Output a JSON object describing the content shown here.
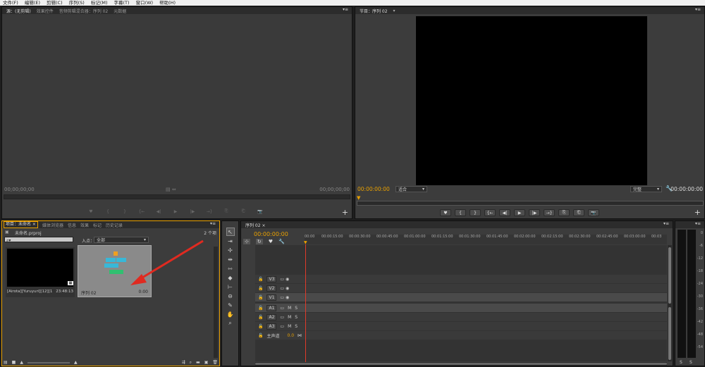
{
  "menu": [
    "文件(F)",
    "编辑(E)",
    "剪辑(C)",
    "序列(S)",
    "标记(M)",
    "字幕(T)",
    "窗口(W)",
    "帮助(H)"
  ],
  "source_panel": {
    "tabs": [
      "源：(无剪辑)",
      "效果控件",
      "音频剪辑混合器：序列 02",
      "元数据"
    ],
    "timecode_left": "00;00;00;00",
    "timecode_right": "00;00;00;00",
    "controls": [
      "♥",
      "{",
      "}",
      "{←",
      "◀|",
      "▶",
      "|▶",
      "→}",
      "⎘",
      "⎗",
      "📷"
    ]
  },
  "program_panel": {
    "tab": "节目：序列 02",
    "timecode_left": "00:00:00:00",
    "fit_select": "适合",
    "quality_select": "完整",
    "timecode_right": "00:00:00:00",
    "controls": [
      "♥",
      "{",
      "}",
      "{←",
      "◀|",
      "▶",
      "|▶",
      "→}",
      "⎘",
      "⎗",
      "📷"
    ]
  },
  "project_panel": {
    "tabs": [
      "项目：未命名",
      "媒体浏览器",
      "信息",
      "效果",
      "标记",
      "历史记录"
    ],
    "project_file": "未命名.prproj",
    "item_count": "2 个项",
    "in_label": "入点：",
    "in_select": "全部",
    "search_placeholder": "",
    "items": [
      {
        "name": "[Airota][Yuruyuri][12][1...",
        "duration": "23:48:13"
      },
      {
        "name": "序列 02",
        "duration": "0:00"
      }
    ]
  },
  "tools": [
    "selection",
    "track-select",
    "ripple",
    "rolling",
    "rate-stretch",
    "razor",
    "slip",
    "slide",
    "pen",
    "hand",
    "zoom"
  ],
  "timeline": {
    "tab": "序列 02",
    "timecode": "00:00:00:00",
    "ruler": [
      "00:00",
      "00:00:15:00",
      "00:00:30:00",
      "00:00:45:00",
      "00:01:00:00",
      "00:01:15:00",
      "00:01:30:00",
      "00:01:45:00",
      "00:02:00:00",
      "00:02:15:00",
      "00:02:30:00",
      "00:02:45:00",
      "00:03:00:00",
      "00:03"
    ],
    "video_tracks": [
      "V3",
      "V2",
      "V1"
    ],
    "audio_tracks": [
      "A1",
      "A2",
      "A3"
    ],
    "master_label": "主声道",
    "master_value": "0.0",
    "mute": "M",
    "solo": "S"
  },
  "meter": {
    "ticks": [
      "0",
      "-6",
      "-12",
      "-18",
      "-24",
      "-30",
      "-36",
      "-42",
      "-48",
      "-54"
    ],
    "solo_labels": [
      "S",
      "S"
    ]
  },
  "colors": {
    "accent": "#e8a000",
    "playhead": "#e03a2a",
    "arrow": "#e02a20"
  }
}
